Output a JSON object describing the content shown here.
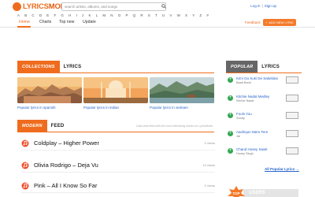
{
  "header": {
    "logo_a": "LYRICS",
    "logo_b": "MODE",
    "search_placeholder": "search artists, albums, and songs",
    "login": "Log in",
    "separator": "|",
    "signup": "Sign up"
  },
  "alphabet": [
    "A",
    "B",
    "C",
    "D",
    "E",
    "F",
    "G",
    "H",
    "I",
    "J",
    "K",
    "L",
    "M",
    "N",
    "O",
    "P",
    "Q",
    "R",
    "S",
    "T",
    "U",
    "V",
    "W",
    "X",
    "Y",
    "Z",
    "#"
  ],
  "nav": {
    "tabs": [
      "Home",
      "Charts",
      "Top new",
      "Update"
    ],
    "feedback": "Feedback",
    "add_lyrics": "ADD NEW LYRIC"
  },
  "collections": {
    "tag": "COLLECTIONS",
    "title": "LYRICS",
    "items": [
      {
        "caption": "Popular lyrics in spanish"
      },
      {
        "caption": "Popular lyrics in indian"
      },
      {
        "caption": "Popular lyrics in vietnam"
      }
    ]
  },
  "feed": {
    "tag": "MODERN",
    "title": "FEED",
    "note": "Data view feed with the most interesting stories on LyricsMode",
    "items": [
      {
        "title": "Coldplay – Higher Power",
        "views": "0 views"
      },
      {
        "title": "Olivia Rodrigo – Deja Vu",
        "views": "10 views"
      },
      {
        "title": "Pink – All I Know So Far",
        "views": "0 views"
      }
    ]
  },
  "popular": {
    "tag": "POPULAR",
    "title": "LYRICS",
    "items": [
      {
        "title": "Kimi Ga Suki De Sakebitai",
        "artist": "Baad Band"
      },
      {
        "title": "Kitchie Nadal Medley",
        "artist": "Kitchie Nadal"
      },
      {
        "title": "Fools You",
        "artist": "Sundy"
      },
      {
        "title": "Aashiqon Mere Tere",
        "artist": "Jai"
      },
      {
        "title": "Chand Hosey Sawit",
        "artist": "Honey Singh"
      }
    ],
    "all_link": "All Popular Lyrics →"
  },
  "users": {
    "badge": "TOP",
    "tag": "USERS"
  },
  "colors": {
    "accent": "#ef6c1e",
    "link": "#2563c9",
    "plus": "#34a853"
  }
}
